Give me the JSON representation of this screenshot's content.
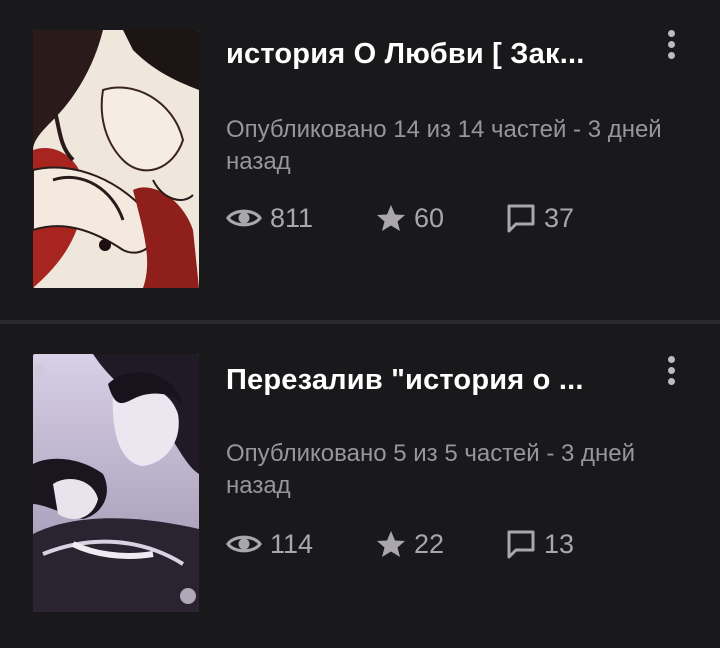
{
  "stories": [
    {
      "title": "история О Любви [ Зак...",
      "published": "Опубликовано 14 из 14 частей - 3 дней назад",
      "views": "811",
      "votes": "60",
      "comments": "37"
    },
    {
      "title": "Перезалив \"история о ...",
      "published": "Опубликовано 5 из 5 частей - 3 дней назад",
      "views": "114",
      "votes": "22",
      "comments": "13"
    }
  ],
  "icons": {
    "views": "eye-icon",
    "votes": "star-icon",
    "comments": "comment-icon",
    "menu": "more-vertical-icon"
  },
  "colors": {
    "background": "#19181a",
    "title": "#ffffff",
    "meta": "#98969b",
    "stats": "#a9a7ab"
  }
}
